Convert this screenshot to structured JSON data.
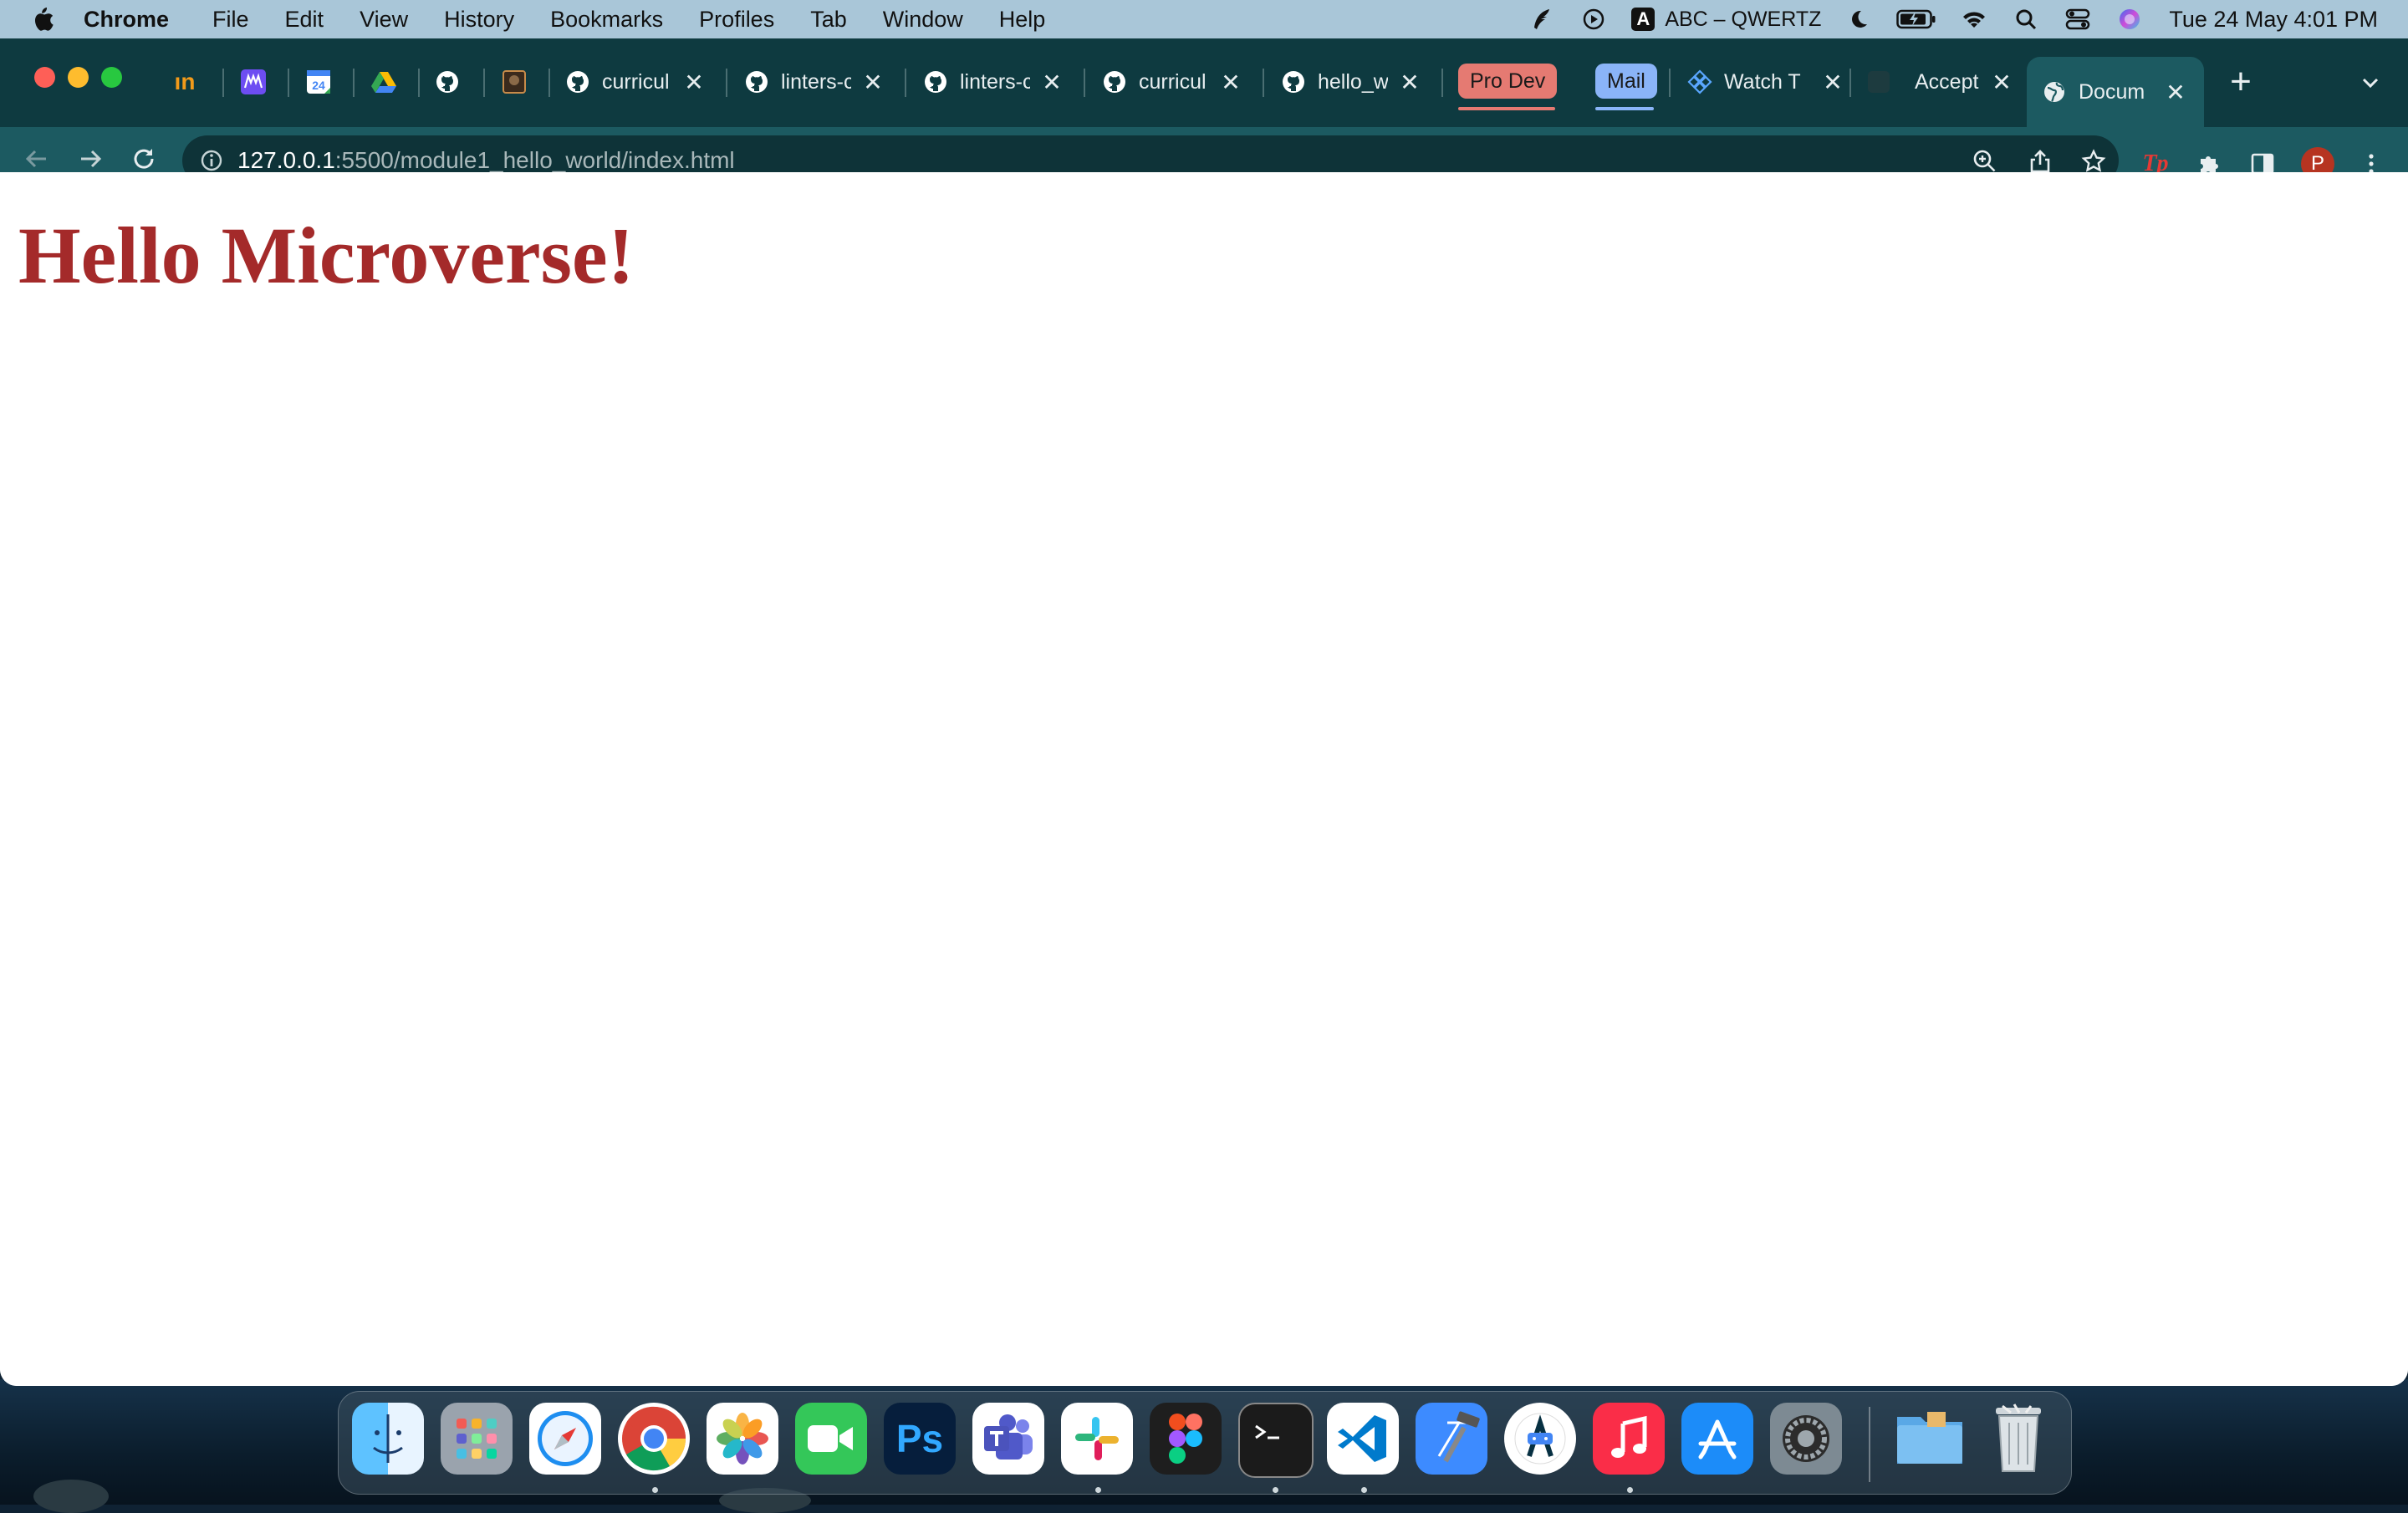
{
  "menubar": {
    "app_name": "Chrome",
    "items": [
      "File",
      "Edit",
      "View",
      "History",
      "Bookmarks",
      "Profiles",
      "Tab",
      "Window",
      "Help"
    ],
    "input_source": "ABC – QWERTZ",
    "datetime": "Tue 24 May  4:01 PM"
  },
  "tabs": [
    {
      "title": "",
      "icon": "meetup-icon"
    },
    {
      "title": "",
      "icon": "microverse-icon"
    },
    {
      "title": "",
      "icon": "calendar-icon"
    },
    {
      "title": "",
      "icon": "google-drive-icon"
    },
    {
      "title": "",
      "icon": "github-icon"
    },
    {
      "title": "",
      "icon": "picture-icon"
    },
    {
      "title": "curricul",
      "icon": "github-icon"
    },
    {
      "title": "linters-c",
      "icon": "github-icon"
    },
    {
      "title": "linters-c",
      "icon": "github-icon"
    },
    {
      "title": "curricul",
      "icon": "github-icon"
    },
    {
      "title": "hello_w",
      "icon": "github-icon"
    },
    {
      "title": "Watch T",
      "icon": "flag-icon"
    },
    {
      "title": "Accept",
      "icon": "dark-square-icon"
    },
    {
      "title": "Docum",
      "icon": "globe-icon"
    }
  ],
  "tab_groups": [
    {
      "label": "Pro Dev",
      "color": "#e57a72"
    },
    {
      "label": "Mail",
      "color": "#8ab4f8"
    }
  ],
  "address_bar": {
    "host": "127.0.0.1",
    "rest": ":5500/module1_hello_world/index.html"
  },
  "profile_initial": "P",
  "page": {
    "heading": "Hello Microverse!",
    "heading_color": "#a42a2a"
  },
  "dock": {
    "apps": [
      "Finder",
      "Launchpad",
      "Safari",
      "Google Chrome",
      "Photos",
      "FaceTime",
      "Photoshop",
      "Microsoft Teams",
      "Slack",
      "Figma",
      "Terminal",
      "Visual Studio Code",
      "Xcode",
      "Android Studio",
      "Music",
      "App Store",
      "System Preferences",
      "Downloads",
      "Trash"
    ],
    "photoshop_label": "Ps"
  }
}
